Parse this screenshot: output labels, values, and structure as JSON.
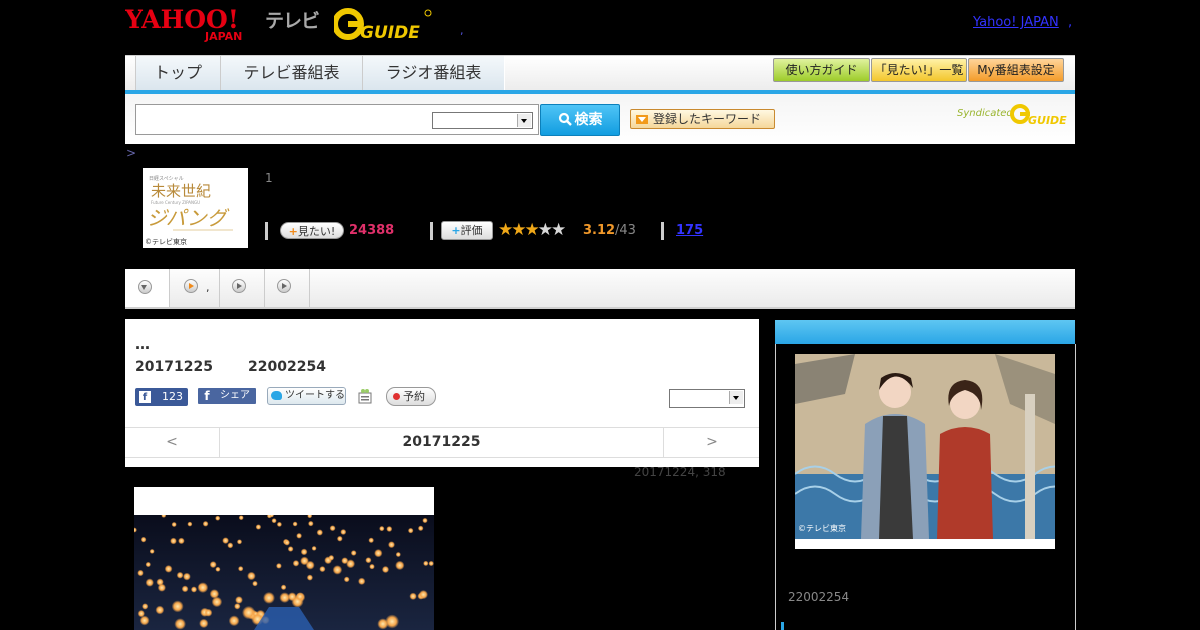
{
  "header": {
    "yahoo_logo_text": "YAHOO!",
    "yahoo_logo_sub": "JAPAN",
    "tv_label": "テレビ",
    "gguide_logo_text": "GUIDE",
    "header_dot": ",",
    "yahoo_japan_link": "Yahoo! JAPAN",
    "yahoo_japan_link_suffix": ","
  },
  "nav": {
    "tabs": [
      {
        "label": "トップ"
      },
      {
        "label": "テレビ番組表"
      },
      {
        "label": "ラジオ番組表"
      }
    ],
    "buttons": {
      "guide": "使い方ガイド",
      "mitai_list": "「見たい!」一覧",
      "my_schedule": "My番組表設定"
    },
    "accent_color": "#2aa6e6"
  },
  "search": {
    "button_label": "検索",
    "keyword_button_label": "登録したキーワード",
    "syndicated_label": "Syndicated",
    "syndicated_logo_text": "GUIDE"
  },
  "breadcrumb": {
    "text": ">"
  },
  "program": {
    "thumb_title": "未来世紀",
    "thumb_title2": "ジパング",
    "thumb_sub": "Future Century ZIPANGU",
    "thumb_copyright": "©テレビ東京",
    "count_label": "1",
    "mitai_button": "見たい!",
    "mitai_count": "24388",
    "rate_button": "評価",
    "rating": 3,
    "rating_max": 5,
    "rating_value": "3.12",
    "rating_count": "/43",
    "review_count": "175"
  },
  "subtabs": {
    "tab2_suffix": ","
  },
  "main": {
    "ellipsis": "…",
    "air_date": "20171225",
    "air_time": "22002254",
    "like_icon": "f",
    "like_count": "123",
    "share_icon": "f",
    "share_label": "シェア",
    "tweet_label": "ツイートする",
    "reserve_label": "予約",
    "date_prev": "<",
    "date_current": "20171225",
    "date_next": ">",
    "updated": "20171224, 318"
  },
  "right": {
    "photo_copyright": "©テレビ東京",
    "time": "22002254"
  }
}
